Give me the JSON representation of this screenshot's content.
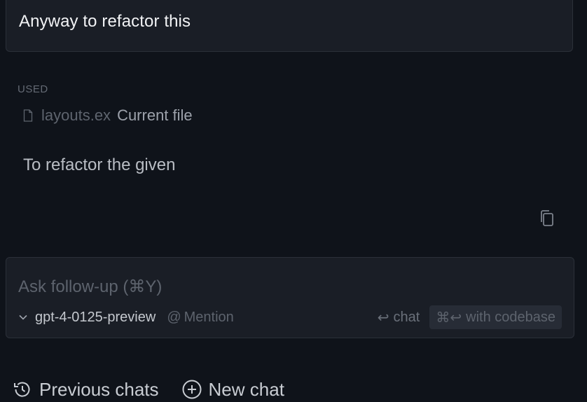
{
  "user_message": {
    "text": "Anyway to refactor this"
  },
  "context": {
    "used_label": "USED",
    "file_name": "layouts.ex",
    "file_tag": "Current file",
    "file_icon": "file-icon"
  },
  "assistant_reply": {
    "text": "To refactor the given",
    "copy_icon": "copy-icon"
  },
  "composer": {
    "placeholder": "Ask follow-up (⌘Y)",
    "model": "gpt-4-0125-preview",
    "mention_label": "Mention",
    "chat_label": "chat",
    "codebase_label": "with codebase"
  },
  "footer": {
    "previous_chats_label": "Previous chats",
    "new_chat_label": "New chat"
  }
}
